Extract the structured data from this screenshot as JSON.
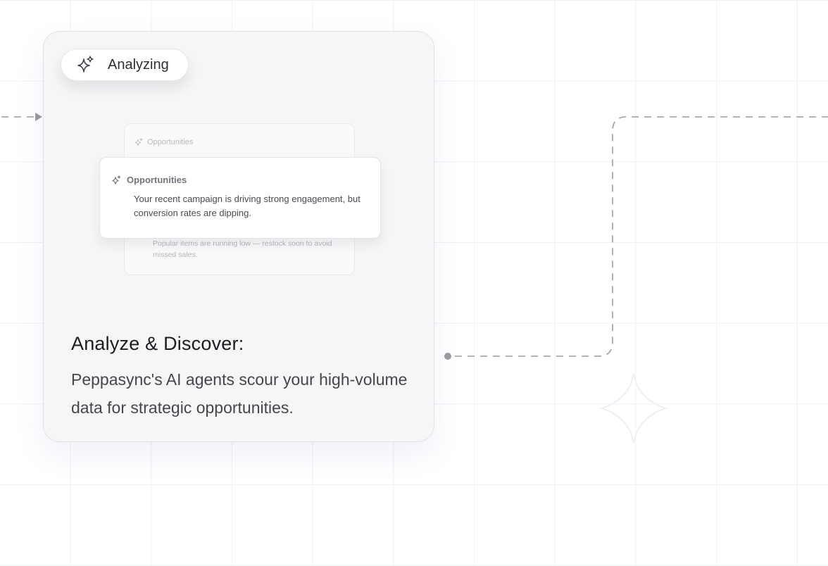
{
  "status_pill": {
    "icon": "sparkle-icon",
    "label": "Analyzing"
  },
  "insight_back": {
    "icon": "sparkle-icon",
    "heading": "Opportunities",
    "text": "Popular items are running low — restock soon to avoid missed sales."
  },
  "insight_front": {
    "icon": "sparkle-icon",
    "heading": "Opportunities",
    "text": "Your recent campaign is driving strong engagement, but conversion rates are dipping."
  },
  "step": {
    "title": "Analyze & Discover:",
    "description": "Peppasync's AI agents scour your high-volume data for strategic opportunities."
  }
}
